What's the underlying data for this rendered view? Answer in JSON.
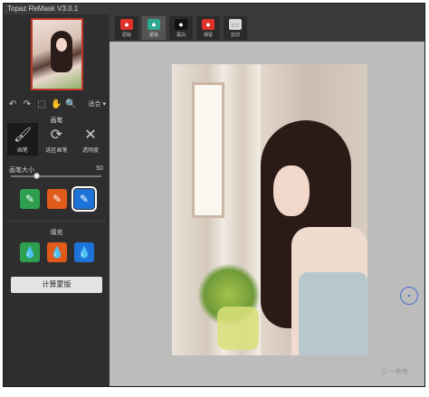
{
  "app": {
    "title": "Topaz ReMask V3.0.1"
  },
  "tabs": [
    {
      "label": "原始",
      "icon": "apple-icon",
      "color": "#e0312a"
    },
    {
      "label": "蒙版",
      "icon": "mask-icon",
      "color": "#2fa98f"
    },
    {
      "label": "黑白",
      "icon": "apple-black-icon",
      "color": "#111111"
    },
    {
      "label": "保留",
      "icon": "apple-red-icon",
      "color": "#e0312a"
    },
    {
      "label": "剪切",
      "icon": "blank-image-icon",
      "color": "#d9d9d9"
    }
  ],
  "toolbar": {
    "zoom_label": "适合 ▾"
  },
  "brush": {
    "section_label": "画笔",
    "buttons": [
      {
        "label": "画笔"
      },
      {
        "label": "选区画笔"
      },
      {
        "label": "透明度"
      }
    ],
    "size_label": "画笔大小",
    "size_value": "50",
    "slider_fraction": 0.28
  },
  "fill": {
    "section_label": "填充"
  },
  "actions": {
    "compute_label": "计算蒙版"
  },
  "watermark": "◎ 一些些"
}
